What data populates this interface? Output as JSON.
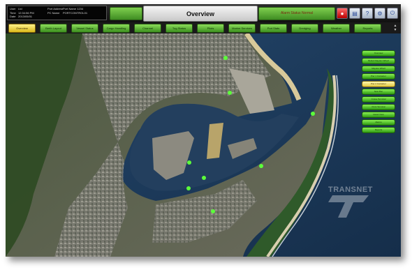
{
  "header": {
    "info": [
      [
        "User",
        "Ltd",
        "Port Address",
        "Port Name 1234"
      ],
      [
        "Time",
        "12:34:56 PM",
        "PC Name",
        "PORTCONTROL01"
      ],
      [
        "Date",
        "2013/05/01",
        "",
        ""
      ]
    ],
    "title": "Overview",
    "status_text": "Alarm Status Normal",
    "icons": [
      "alarm-icon",
      "print-icon",
      "help-icon",
      "settings-icon",
      "logout-icon"
    ]
  },
  "nav": {
    "tabs": [
      "Overview",
      "Berth Layout",
      "Vessel Status",
      "Cargo Handling",
      "Channel",
      "Tug Status",
      "Pilots",
      "Marine Services",
      "Port Stats",
      "Dredging",
      "Weather",
      "Reports"
    ],
    "active_index": 0
  },
  "side_menu": {
    "items": [
      "Overview",
      "Bulkoil Maydon Wharf",
      "Maydon Wharf",
      "Pier 1 Container",
      "Pier 2 Container",
      "New Pier",
      "Cruise Terminal",
      "Point Terminal",
      "Island View",
      "Alarms",
      "Reports"
    ],
    "active_index": 4
  },
  "watermark": {
    "text": "TRANSNET"
  },
  "colors": {
    "accent_green": "#4caf2a",
    "active_yellow": "#e2c640",
    "header_dark": "#111111",
    "sea": "#1f3a5c"
  }
}
